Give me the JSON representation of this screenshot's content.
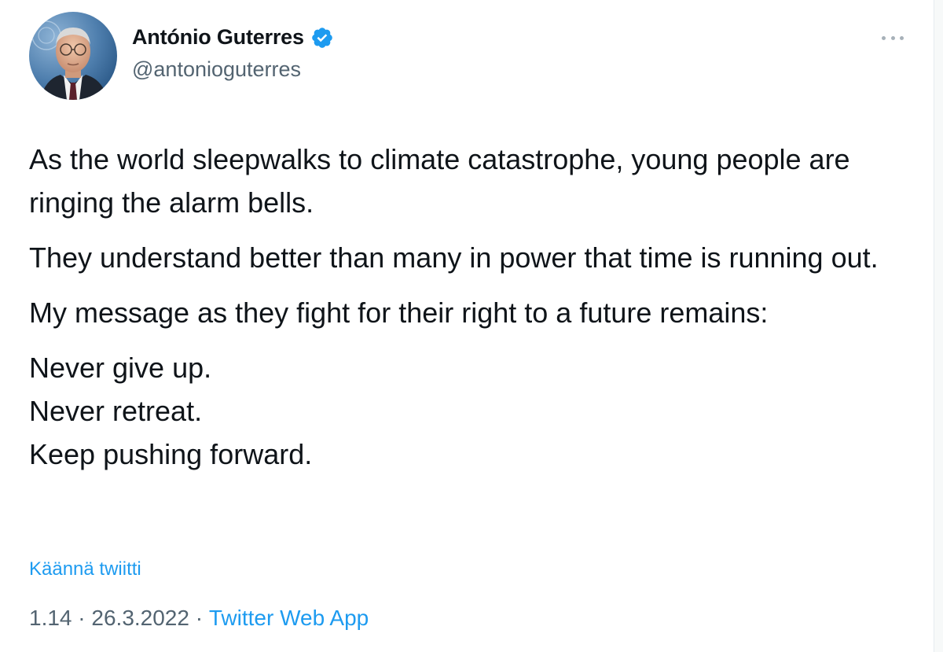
{
  "author": {
    "display_name": "António Guterres",
    "handle": "@antonioguterres",
    "verified": true
  },
  "tweet": {
    "paragraphs": [
      "As the world sleepwalks to climate catastrophe, young people are ringing the alarm bells.",
      "They understand better than many in power that time is running out.",
      "My message as they fight for their right to a future remains:"
    ],
    "closing_lines": [
      "Never give up.",
      "Never retreat.",
      "Keep pushing forward."
    ]
  },
  "translate_label": "Käännä twiitti",
  "meta": {
    "time": "1.14",
    "separator": " · ",
    "date": "26.3.2022",
    "source": "Twitter Web App"
  },
  "colors": {
    "link": "#1d9bf0",
    "secondary_text": "#536471",
    "primary_text": "#0f1419",
    "verified": "#1d9bf0"
  },
  "icons": {
    "verified": "verified-badge-icon",
    "more": "more-options-icon"
  }
}
